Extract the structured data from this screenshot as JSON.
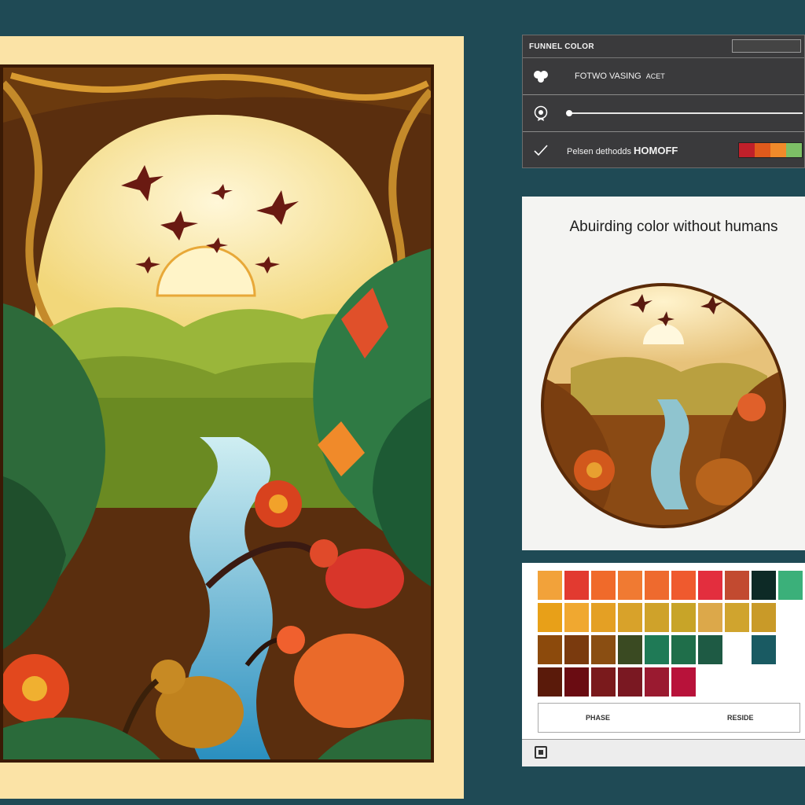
{
  "panel": {
    "header_title": "FUNNEL COLOR",
    "header_button": "",
    "row1_label": "FOTWO VASING",
    "row1_sublabel": "ACET",
    "row3_label": "Pelsen dethodds",
    "row3_value": "HOMOFF",
    "mini_swatches": [
      "#c0202a",
      "#e05a1c",
      "#f08a2a",
      "#7dbf66"
    ]
  },
  "preview": {
    "title": "Abuirding color without humans"
  },
  "palette": {
    "rows": [
      [
        "#f2a23a",
        "#e23a30",
        "#f06a2a",
        "#f07a32",
        "#ee6a2e",
        "#ef5a2e",
        "#e32e3e",
        "#c24a30",
        "#0d2a26",
        "#3bb07a"
      ],
      [
        "#e8a018",
        "#f0a830",
        "#e4a024",
        "#d8a22a",
        "#cfa22a",
        "#c8a428",
        "#dca84a",
        "#d0a42e",
        "#c99a28"
      ],
      [
        "#8c4a0c",
        "#7a3a0e",
        "#8a4e12",
        "#3a4a22",
        "#1f7a56",
        "#1f6e4a",
        "#1e5a44",
        "#ffffff",
        "#195a62"
      ],
      [
        "#5a1a0a",
        "#6a0c12",
        "#7a1a1c",
        "#7a1822",
        "#9a1a30",
        "#b8123a"
      ]
    ],
    "footer_left": "PHASE",
    "footer_right": "RESIDE"
  },
  "colors": {
    "background": "#1f4a55",
    "poster_mat": "#fbe3a6",
    "panel_bg": "#3a3a3c"
  }
}
